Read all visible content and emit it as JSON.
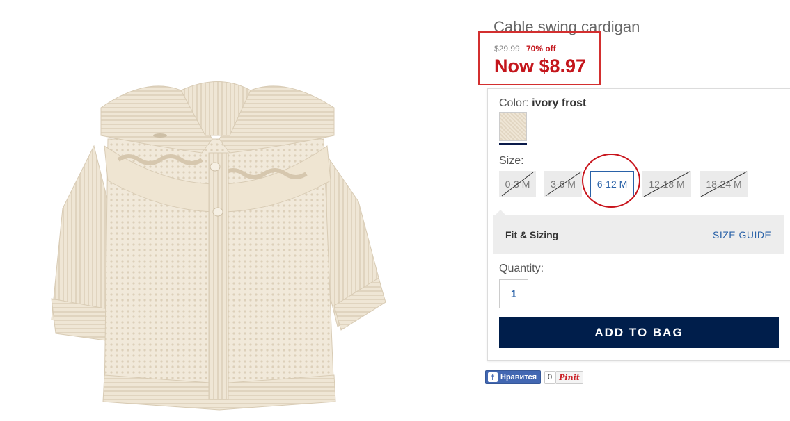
{
  "product": {
    "title": "Cable swing cardigan",
    "old_price": "$29.99",
    "discount": "70% off",
    "now_price": "Now $8.97"
  },
  "color": {
    "label": "Color:",
    "value": "ivory frost"
  },
  "size": {
    "label": "Size:",
    "options": [
      {
        "label": "0-3 M",
        "available": false
      },
      {
        "label": "3-6 M",
        "available": false
      },
      {
        "label": "6-12 M",
        "available": true,
        "selected": true
      },
      {
        "label": "12-18 M",
        "available": false
      },
      {
        "label": "18-24 M",
        "available": false
      }
    ]
  },
  "fit": {
    "label": "Fit & Sizing",
    "guide_link": "SIZE GUIDE"
  },
  "quantity": {
    "label": "Quantity:",
    "value": "1"
  },
  "add_to_bag": "ADD TO BAG",
  "social": {
    "fb_label": "Нравится",
    "pin_count": "0",
    "pin_label": "Pinit"
  },
  "colors": {
    "sale_red": "#c4161c",
    "link_blue": "#2a62a8",
    "navy": "#001e4b",
    "highlight_red": "#d32f2f"
  }
}
